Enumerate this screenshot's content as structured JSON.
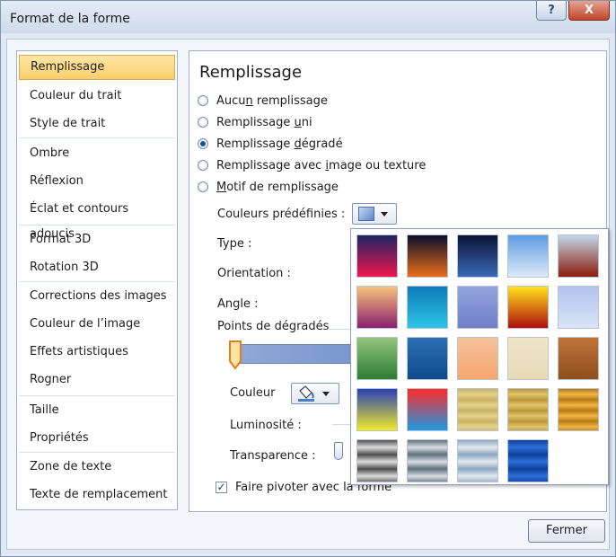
{
  "window": {
    "title": "Format de la forme",
    "help_glyph": "?",
    "close_glyph": "X"
  },
  "sidebar": {
    "items": [
      "Remplissage",
      "Couleur du trait",
      "Style de trait",
      "Ombre",
      "Réflexion",
      "Éclat et contours adoucis",
      "Format 3D",
      "Rotation 3D",
      "Corrections des images",
      "Couleur de l’image",
      "Effets artistiques",
      "Rogner",
      "Taille",
      "Propriétés",
      "Zone de texte",
      "Texte de remplacement"
    ],
    "selected": "Remplissage"
  },
  "panel": {
    "heading": "Remplissage",
    "options": [
      {
        "label": "Aucun remplissage",
        "selected": false
      },
      {
        "label": "Remplissage uni",
        "selected": false
      },
      {
        "label": "Remplissage dégradé",
        "selected": true
      },
      {
        "label": "Remplissage avec image ou texture",
        "selected": false
      },
      {
        "label": "Motif de remplissage",
        "selected": false
      }
    ],
    "preset_label": "Couleurs prédéfinies :",
    "type_label": "Type :",
    "orientation_label": "Orientation :",
    "angle_label": "Angle :",
    "stops_label": "Points de dégradés",
    "color_label": "Couleur",
    "luminosity_label": "Luminosité :",
    "transparency_label": "Transparence :",
    "rotate_label": "Faire pivoter avec la forme",
    "rotate_checked": true,
    "preset_icon": "gradient-swatch-icon",
    "color_icon": "paint-bucket-icon"
  },
  "presets": [
    [
      "#1d2466",
      "#f0164a"
    ],
    [
      "#0a0f2e",
      "#eb6d18"
    ],
    [
      "#0a1435",
      "#3a67b7"
    ],
    [
      "#5f9ce3",
      "#dceaf8"
    ],
    [
      "#c4d6ea",
      "#8b1c0d"
    ],
    [
      "#f7c37a",
      "#8a1e6f"
    ],
    [
      "#0f7bb9",
      "#2ec4e6"
    ],
    [
      "#93a3dd",
      "#6f7fc9"
    ],
    [
      "#ffe21a",
      "#b00f0f"
    ],
    [
      "#b3c3ee",
      "#d9e4f6"
    ],
    [
      "#93c47c",
      "#2c7d33"
    ],
    [
      "#2d6fb2",
      "#0c4a8c"
    ],
    [
      "#f6c29b",
      "#f7a66f"
    ],
    [
      "#efe5c9",
      "#e7dbb6"
    ],
    [
      "#c07438",
      "#8c4e1d"
    ],
    [
      "#283fb5",
      "#f0ea2a"
    ],
    [
      "#ff2a2a",
      "#1e9ae2"
    ],
    [
      "#c7b263",
      "#e5d38c"
    ],
    [
      "#b89637",
      "#e1c66c"
    ],
    [
      "#b67a13",
      "#f0b545"
    ],
    [
      "#4c4c4c",
      "#dcdcdc"
    ],
    [
      "#5f6f7b",
      "#d7dee4"
    ],
    [
      "#8ea6c1",
      "#e2e9f2"
    ],
    [
      "#0f3f9c",
      "#2f6fd6"
    ]
  ],
  "footer": {
    "close_label": "Fermer"
  },
  "colors": {
    "selection_bg": "#f9cf6c",
    "accent": "#1a4f9c"
  }
}
